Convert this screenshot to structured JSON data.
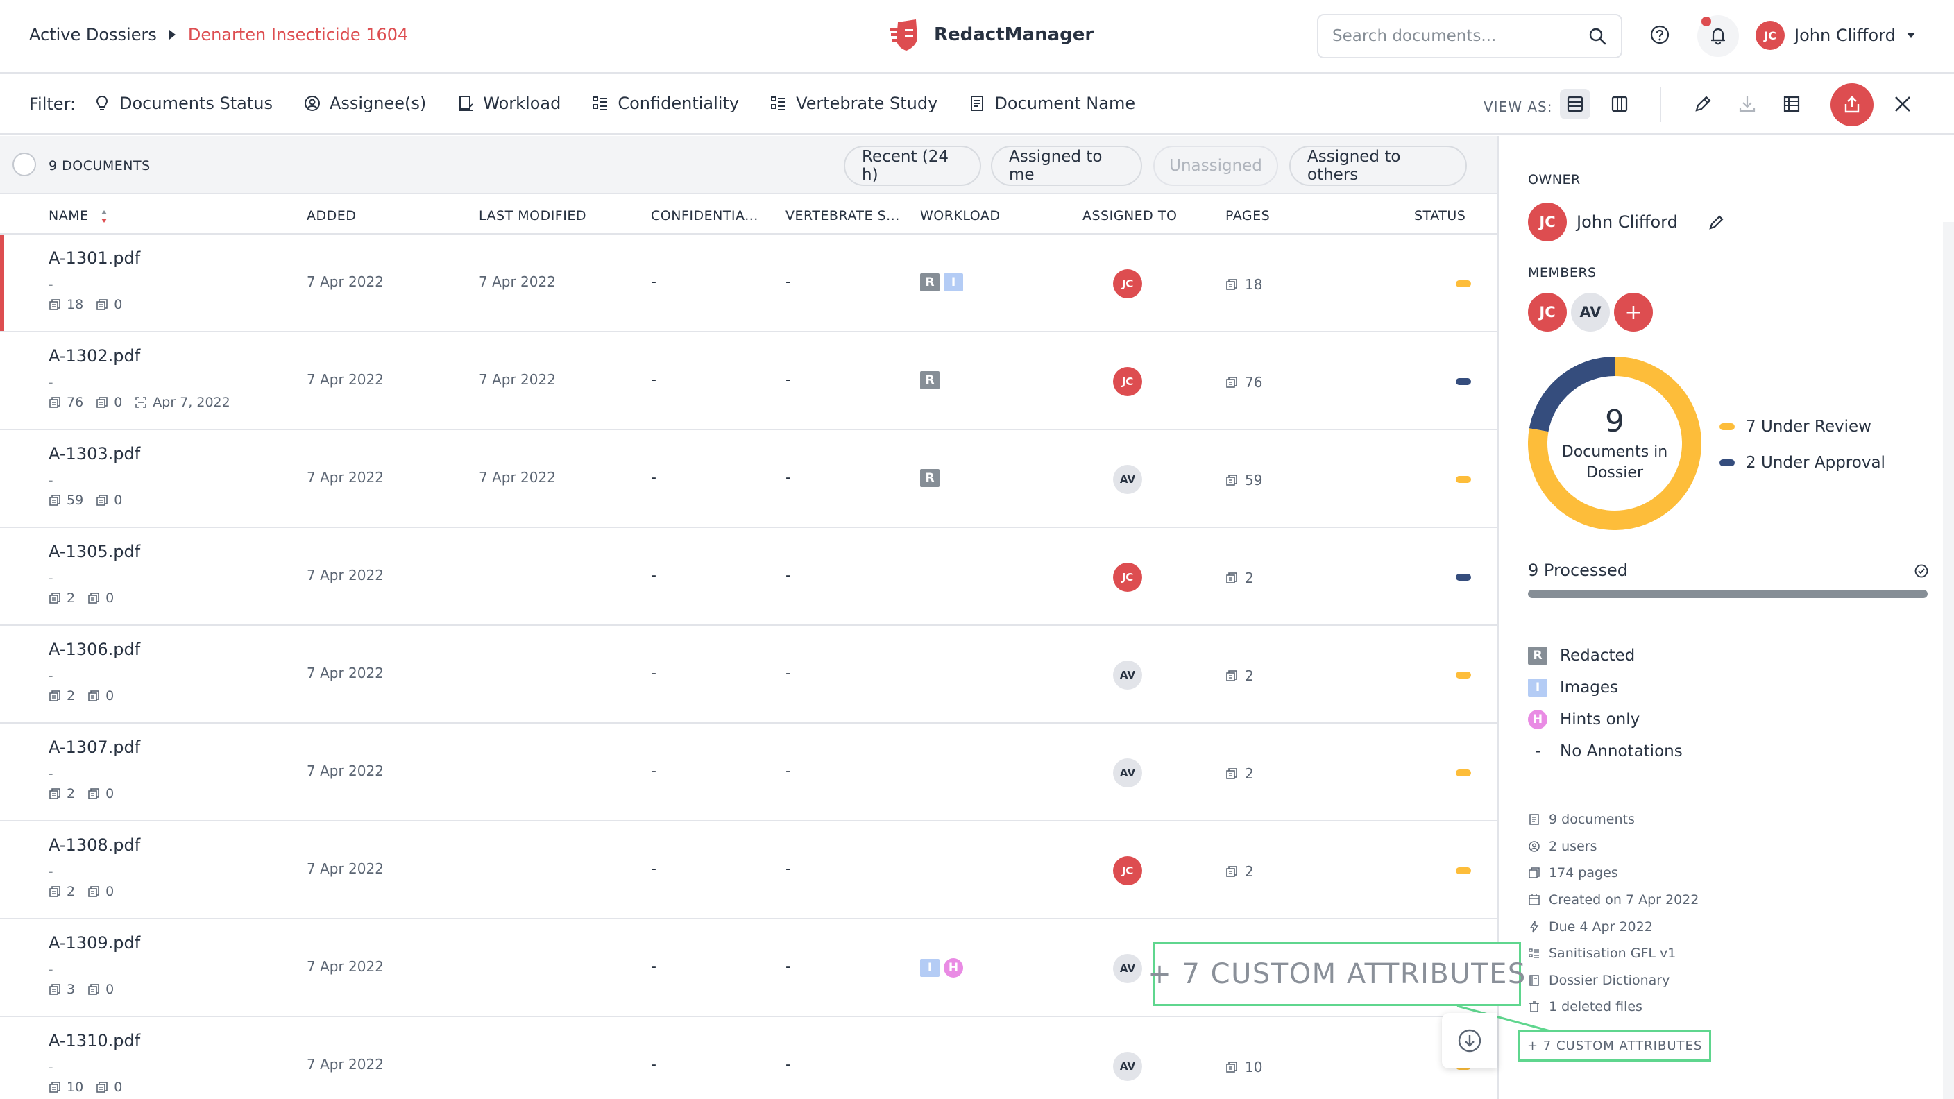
{
  "breadcrumb": {
    "root": "Active Dossiers",
    "current": "Denarten Insecticide 1604"
  },
  "brand": {
    "name": "RedactManager"
  },
  "search": {
    "placeholder": "Search documents..."
  },
  "user": {
    "initials": "JC",
    "name": "John Clifford"
  },
  "filter_bar": {
    "label": "Filter:",
    "filters": [
      "Documents Status",
      "Assignee(s)",
      "Workload",
      "Confidentiality",
      "Vertebrate Study",
      "Document Name"
    ],
    "view_as_label": "VIEW AS:"
  },
  "quick_filters": {
    "doc_count": "9 DOCUMENTS",
    "chips": [
      "Recent (24 h)",
      "Assigned to me",
      "Unassigned",
      "Assigned to others"
    ]
  },
  "table": {
    "columns": [
      "NAME",
      "ADDED",
      "LAST MODIFIED",
      "CONFIDENTIA...",
      "VERTEBRATE S...",
      "WORKLOAD",
      "ASSIGNED TO",
      "PAGES",
      "STATUS"
    ],
    "rows": [
      {
        "name": "A-1301.pdf",
        "dash": "-",
        "pages_meta": "18",
        "annotations_meta": "0",
        "ocr_date": "",
        "added": "7 Apr 2022",
        "modified": "7 Apr 2022",
        "confidentiality": "-",
        "vertebrate": "-",
        "workload": [
          "R",
          "I"
        ],
        "assignee": "JC",
        "assignee_color": "red",
        "pages": "18",
        "status": "Under Review",
        "status_color": "#fdbd3a"
      },
      {
        "name": "A-1302.pdf",
        "dash": "-",
        "pages_meta": "76",
        "annotations_meta": "0",
        "ocr_date": "Apr 7, 2022",
        "added": "7 Apr 2022",
        "modified": "7 Apr 2022",
        "confidentiality": "-",
        "vertebrate": "-",
        "workload": [
          "R"
        ],
        "assignee": "JC",
        "assignee_color": "red",
        "pages": "76",
        "status": "Under Approval",
        "status_color": "#354d7d"
      },
      {
        "name": "A-1303.pdf",
        "dash": "-",
        "pages_meta": "59",
        "annotations_meta": "0",
        "ocr_date": "",
        "added": "7 Apr 2022",
        "modified": "7 Apr 2022",
        "confidentiality": "-",
        "vertebrate": "-",
        "workload": [
          "R"
        ],
        "assignee": "AV",
        "assignee_color": "gray",
        "pages": "59",
        "status": "Under Review",
        "status_color": "#fdbd3a"
      },
      {
        "name": "A-1305.pdf",
        "dash": "-",
        "pages_meta": "2",
        "annotations_meta": "0",
        "ocr_date": "",
        "added": "7 Apr 2022",
        "modified": "",
        "confidentiality": "-",
        "vertebrate": "-",
        "workload": [],
        "assignee": "JC",
        "assignee_color": "red",
        "pages": "2",
        "status": "Under Approval",
        "status_color": "#354d7d"
      },
      {
        "name": "A-1306.pdf",
        "dash": "-",
        "pages_meta": "2",
        "annotations_meta": "0",
        "ocr_date": "",
        "added": "7 Apr 2022",
        "modified": "",
        "confidentiality": "-",
        "vertebrate": "-",
        "workload": [],
        "assignee": "AV",
        "assignee_color": "gray",
        "pages": "2",
        "status": "Under Review",
        "status_color": "#fdbd3a"
      },
      {
        "name": "A-1307.pdf",
        "dash": "-",
        "pages_meta": "2",
        "annotations_meta": "0",
        "ocr_date": "",
        "added": "7 Apr 2022",
        "modified": "",
        "confidentiality": "-",
        "vertebrate": "-",
        "workload": [],
        "assignee": "AV",
        "assignee_color": "gray",
        "pages": "2",
        "status": "Under Review",
        "status_color": "#fdbd3a"
      },
      {
        "name": "A-1308.pdf",
        "dash": "-",
        "pages_meta": "2",
        "annotations_meta": "0",
        "ocr_date": "",
        "added": "7 Apr 2022",
        "modified": "",
        "confidentiality": "-",
        "vertebrate": "-",
        "workload": [],
        "assignee": "JC",
        "assignee_color": "red",
        "pages": "2",
        "status": "Under Review",
        "status_color": "#fdbd3a"
      },
      {
        "name": "A-1309.pdf",
        "dash": "-",
        "pages_meta": "3",
        "annotations_meta": "0",
        "ocr_date": "",
        "added": "7 Apr 2022",
        "modified": "",
        "confidentiality": "-",
        "vertebrate": "-",
        "workload": [
          "I",
          "H"
        ],
        "assignee": "AV",
        "assignee_color": "gray",
        "pages": "",
        "status": "",
        "status_color": ""
      },
      {
        "name": "A-1310.pdf",
        "dash": "-",
        "pages_meta": "10",
        "annotations_meta": "0",
        "ocr_date": "",
        "added": "7 Apr 2022",
        "modified": "",
        "confidentiality": "-",
        "vertebrate": "-",
        "workload": [],
        "assignee": "AV",
        "assignee_color": "gray",
        "pages": "10",
        "status": "Under Review",
        "status_color": "#fdbd3a"
      }
    ]
  },
  "panel": {
    "owner_label": "OWNER",
    "owner": {
      "initials": "JC",
      "name": "John Clifford"
    },
    "members_label": "MEMBERS",
    "members": [
      {
        "initials": "JC",
        "color": "red"
      },
      {
        "initials": "AV",
        "color": "gray"
      }
    ],
    "add_member_symbol": "+",
    "donut": {
      "total": "9",
      "center_label": "Documents in Dossier",
      "segments": [
        {
          "label": "7 Under Review",
          "value": 7,
          "color": "#fdbd3a"
        },
        {
          "label": "2 Under Approval",
          "value": 2,
          "color": "#354d7d"
        }
      ]
    },
    "processed": {
      "label": "9 Processed",
      "fraction": 1.0
    },
    "workload_legend": [
      {
        "badge": "R",
        "label": "Redacted"
      },
      {
        "badge": "I",
        "label": "Images"
      },
      {
        "badge": "H",
        "label": "Hints only"
      },
      {
        "badge": "-",
        "label": "No Annotations"
      }
    ],
    "stats": [
      {
        "icon": "document-icon",
        "text": "9 documents"
      },
      {
        "icon": "users-icon",
        "text": "2 users"
      },
      {
        "icon": "pages-icon",
        "text": "174 pages"
      },
      {
        "icon": "calendar-icon",
        "text": "Created on 7 Apr 2022"
      },
      {
        "icon": "lightning-icon",
        "text": "Due 4 Apr 2022"
      },
      {
        "icon": "template-icon",
        "text": "Sanitisation GFL v1"
      },
      {
        "icon": "dictionary-icon",
        "text": "Dossier Dictionary"
      },
      {
        "icon": "trash-icon",
        "text": "1 deleted files"
      }
    ],
    "custom_attributes": "+ 7 CUSTOM ATTRIBUTES"
  },
  "zoom_callout": {
    "text": "+ 7 CUSTOM ATTRIBUTES"
  },
  "colors": {
    "accent": "#dd4d50",
    "under_review": "#fdbd3a",
    "under_approval": "#354d7d",
    "highlight": "#5fd68e"
  }
}
